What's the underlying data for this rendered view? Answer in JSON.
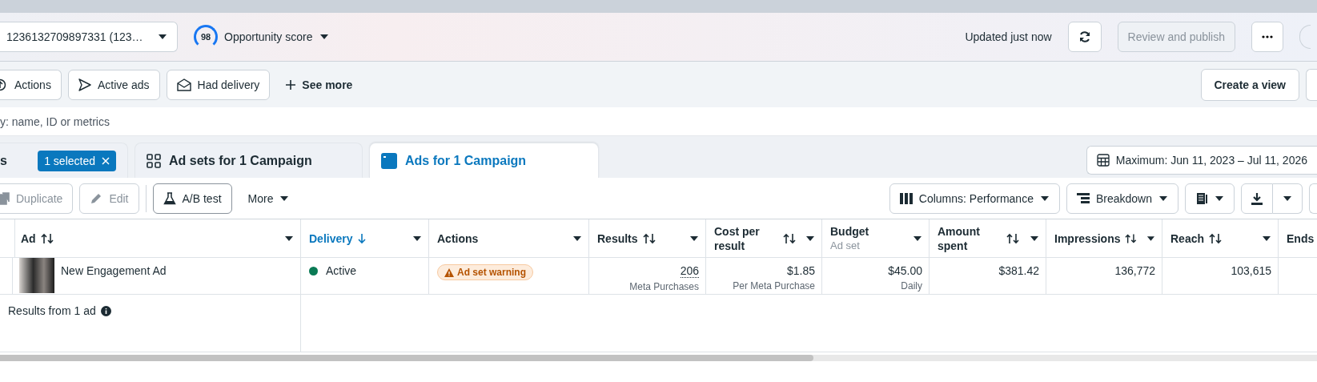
{
  "header": {
    "account": "1236132709897331 (123…",
    "score": "98",
    "score_label": "Opportunity score",
    "updated": "Updated just now",
    "publish": {
      "label": "Review and publish",
      "disabled": true
    }
  },
  "filters": [
    {
      "label": "Actions",
      "kind": "actions"
    },
    {
      "label": "Active ads",
      "kind": "send"
    },
    {
      "label": "Had delivery",
      "kind": "mail"
    }
  ],
  "see_more": "See more",
  "create_view": "Create a view",
  "search": {
    "placeholder": "y: name, ID or metrics"
  },
  "tabs": [
    {
      "label": "s",
      "selected": false,
      "badge": "1 selected",
      "kind": "campaigns"
    },
    {
      "label": "Ad sets for 1 Campaign",
      "selected": false,
      "kind": "adsets"
    },
    {
      "label": "Ads for 1 Campaign",
      "selected": true,
      "kind": "ads"
    }
  ],
  "date_range": "Maximum: Jun 11, 2023 – Jul 11, 2026",
  "toolbar": {
    "buttons": [
      {
        "label": "Duplicate",
        "disabled": true,
        "kind": "duplicate"
      },
      {
        "label": "Edit",
        "disabled": true,
        "kind": "edit"
      },
      {
        "label": "A/B test",
        "disabled": false,
        "kind": "flask"
      }
    ],
    "more": "More",
    "columns": "Columns: Performance",
    "breakdown": "Breakdown"
  },
  "table": {
    "columns": [
      {
        "label": "Ad",
        "sortable": true,
        "sorted": false,
        "kind": "ad"
      },
      {
        "label": "Delivery",
        "sortable": true,
        "sorted": true,
        "kind": "delivery"
      },
      {
        "label": "Actions",
        "sortable": false,
        "sorted": false,
        "kind": "actions"
      },
      {
        "label": "Results",
        "sortable": true,
        "sorted": false,
        "kind": "metric"
      },
      {
        "label": "Cost per result",
        "sortable": true,
        "sorted": false,
        "kind": "metric"
      },
      {
        "label": "Budget",
        "sub": "Ad set",
        "sortable": false,
        "sorted": false,
        "kind": "metric"
      },
      {
        "label": "Amount spent",
        "sortable": true,
        "sorted": false,
        "kind": "metric"
      },
      {
        "label": "Impressions",
        "sortable": true,
        "sorted": false,
        "kind": "metric"
      },
      {
        "label": "Reach",
        "sortable": true,
        "sorted": false,
        "kind": "metric"
      },
      {
        "label": "Ends",
        "kind": "metric"
      }
    ],
    "rows": [
      {
        "cells": [
          {
            "text": "New Engagement Ad"
          },
          {
            "text": "Active",
            "color": "#0a7a55"
          },
          {
            "text": "Ad set warning"
          },
          {
            "text": "206",
            "sub": "Meta Purchases"
          },
          {
            "text": "$1.85",
            "sub": "Per Meta Purchase"
          },
          {
            "text": "$45.00",
            "sub": "Daily"
          },
          {
            "text": "$381.42"
          },
          {
            "text": "136,772"
          },
          {
            "text": "103,615"
          }
        ]
      }
    ],
    "summary": "Results from 1 ad"
  }
}
